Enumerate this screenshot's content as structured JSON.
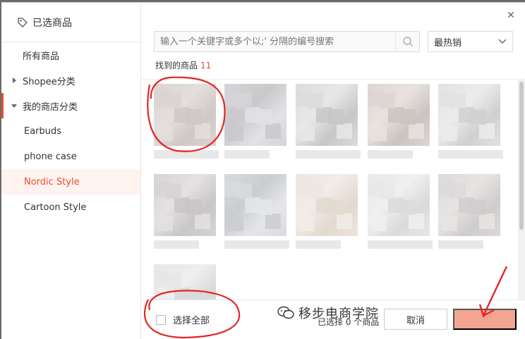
{
  "sidebar": {
    "title": "已选商品",
    "items": [
      {
        "label": "所有商品"
      },
      {
        "label": "Shopee分类"
      },
      {
        "label": "我的商店分类"
      },
      {
        "label": "Earbuds"
      },
      {
        "label": "phone case"
      },
      {
        "label": "Nordic Style"
      },
      {
        "label": "Cartoon Style"
      }
    ]
  },
  "search": {
    "placeholder": "输入一个关键字或多个以;' 分隔的编号搜索"
  },
  "sort": {
    "selected": "最热销"
  },
  "results": {
    "label": "找到的商品",
    "count": "11"
  },
  "footer": {
    "select_all": "选择全部",
    "selected_text": "已选择 0 个商品",
    "cancel_label": "取消",
    "confirm_label": ""
  },
  "watermark": {
    "text": "移步电商学院"
  },
  "colors": {
    "accent": "#ee4d2d",
    "annotation": "#e32626"
  }
}
